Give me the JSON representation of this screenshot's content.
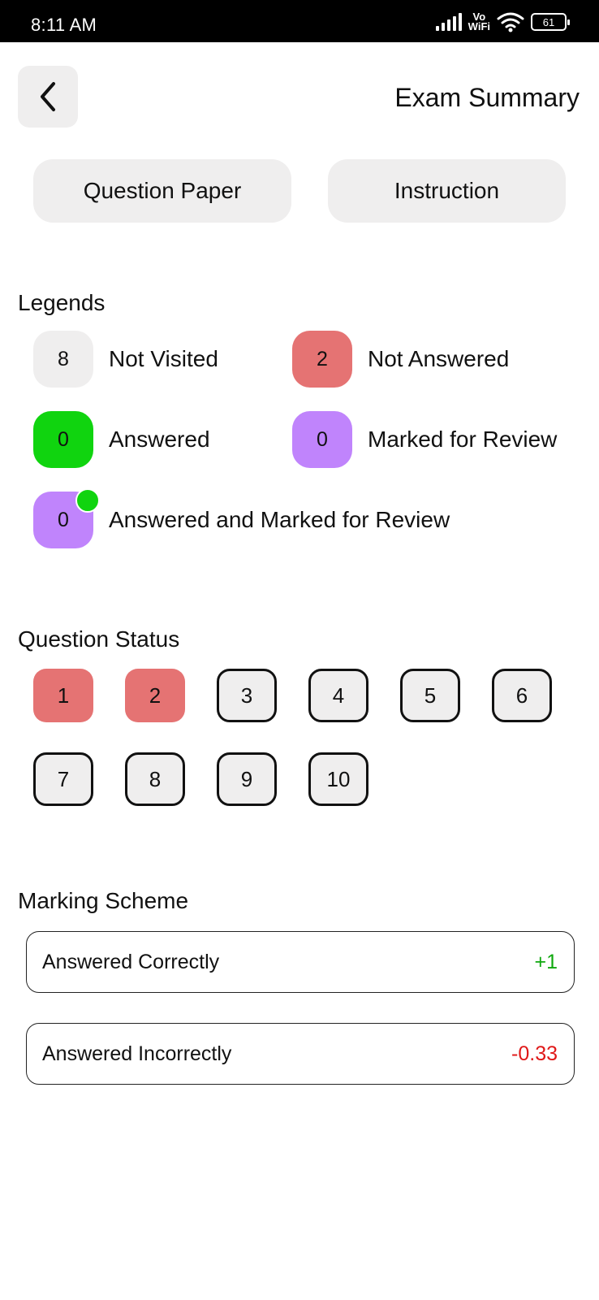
{
  "status_bar": {
    "time": "8:11 AM",
    "network_label_top": "Vo",
    "network_label_bottom": "WiFi",
    "battery": "61"
  },
  "header": {
    "back_icon": "chevron-left-icon",
    "title": "Exam Summary"
  },
  "tabs": [
    {
      "label": "Question Paper"
    },
    {
      "label": "Instruction"
    }
  ],
  "legends": {
    "title": "Legends",
    "items": [
      {
        "count": "8",
        "label": "Not Visited",
        "color": "#efeeee"
      },
      {
        "count": "2",
        "label": "Not Answered",
        "color": "#e57373"
      },
      {
        "count": "0",
        "label": "Answered",
        "color": "#10d40f"
      },
      {
        "count": "0",
        "label": "Marked for Review",
        "color": "#c084fc"
      },
      {
        "count": "0",
        "label": "Answered and Marked for Review",
        "color": "#c084fc"
      }
    ]
  },
  "question_status": {
    "title": "Question Status",
    "questions": [
      {
        "number": "1",
        "status": "not-answered"
      },
      {
        "number": "2",
        "status": "not-answered"
      },
      {
        "number": "3",
        "status": "not-visited"
      },
      {
        "number": "4",
        "status": "not-visited"
      },
      {
        "number": "5",
        "status": "not-visited"
      },
      {
        "number": "6",
        "status": "not-visited"
      },
      {
        "number": "7",
        "status": "not-visited"
      },
      {
        "number": "8",
        "status": "not-visited"
      },
      {
        "number": "9",
        "status": "not-visited"
      },
      {
        "number": "10",
        "status": "not-visited"
      }
    ]
  },
  "marking_scheme": {
    "title": "Marking Scheme",
    "rows": [
      {
        "label": "Answered Correctly",
        "value": "+1",
        "color": "#10a80f"
      },
      {
        "label": "Answered Incorrectly",
        "value": "-0.33",
        "color": "#e01818"
      }
    ]
  }
}
